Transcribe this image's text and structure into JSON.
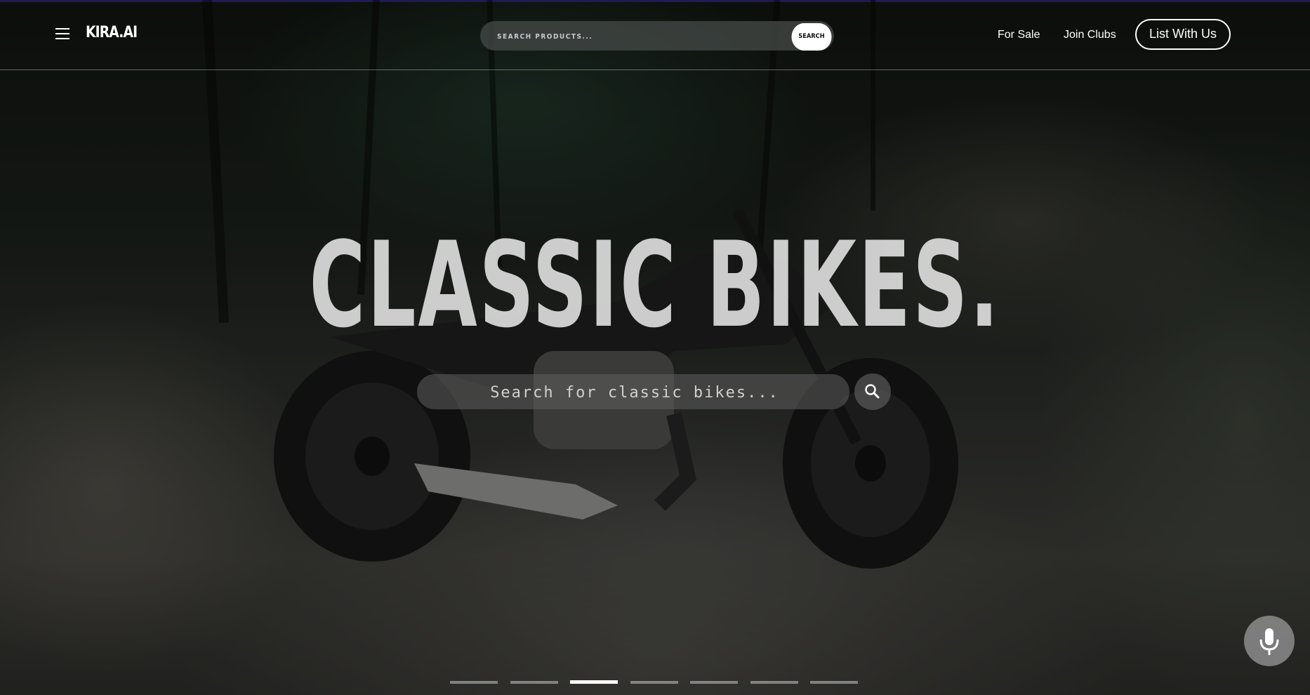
{
  "nav": {
    "logo": "KIRA.AI",
    "search_placeholder": "SEARCH PRODUCTS...",
    "search_button": "SEARCH",
    "links": [
      "For Sale",
      "Join Clubs"
    ],
    "cta": "List With Us"
  },
  "hero": {
    "headline": "CLASSIC BIKES.",
    "search_placeholder": "Search for classic bikes..."
  },
  "slider": {
    "count": 7,
    "active_index": 2
  },
  "icons": {
    "menu": "hamburger-menu-icon",
    "search": "magnifier-icon",
    "mic": "microphone-icon"
  }
}
